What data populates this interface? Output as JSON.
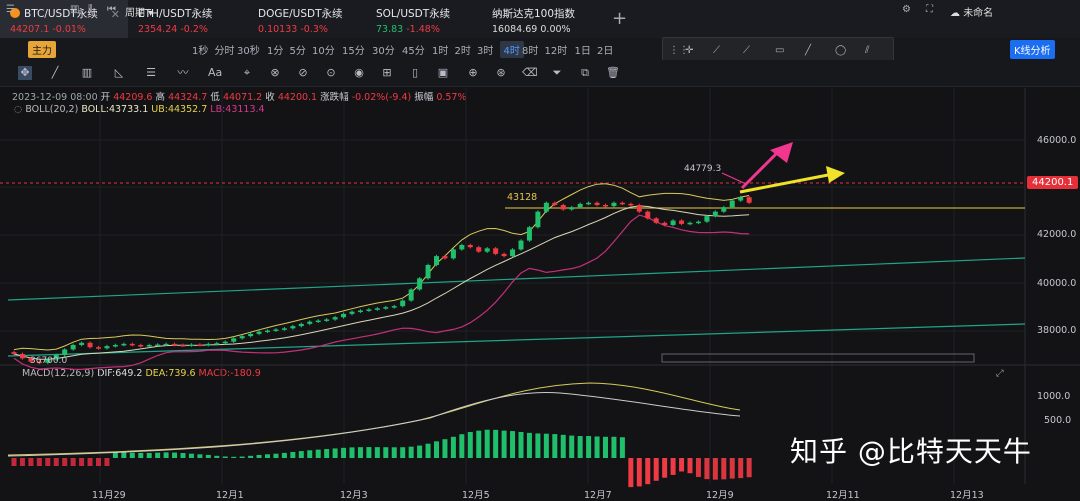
{
  "tabs": [
    {
      "symbol": "BTC/USDT永续",
      "price": "44207.1",
      "change": "-0.01%",
      "active": true
    },
    {
      "symbol": "ETH/USDT永续",
      "price": "2354.24",
      "change": "-0.2%"
    },
    {
      "symbol": "DOGE/USDT永续",
      "price": "0.10133",
      "change": "-0.3%"
    },
    {
      "symbol": "SOL/USDT永续",
      "price": "73.83",
      "change": "-1.48%"
    },
    {
      "symbol": "纳斯达克100指数",
      "price": "16084.69",
      "change": "0.00%"
    }
  ],
  "add_tab": "+",
  "toolbar": {
    "main_label": "主力",
    "period_label": "周期",
    "intervals": [
      "1秒",
      "分时",
      "30秒",
      "1分",
      "5分",
      "10分",
      "15分",
      "30分",
      "45分",
      "1时",
      "2时",
      "3时",
      "4时",
      "8时",
      "12时",
      "1日",
      "2日"
    ],
    "active_interval": "4时",
    "unnamed": "未命名",
    "kline_analysis": "K线分析"
  },
  "ohlc": {
    "date": "2023-12-09 08:00",
    "open_label": "开",
    "open": "44209.6",
    "high_label": "高",
    "high": "44324.7",
    "low_label": "低",
    "low": "44071.2",
    "close_label": "收",
    "close": "44200.1",
    "change_label": "涨跌幅",
    "change": "-0.02%(-9.4)",
    "amp_label": "振幅",
    "amp": "0.57%"
  },
  "boll": {
    "name": "BOLL(20,2)",
    "mid": "BOLL:43733.1",
    "ub": "UB:44352.7",
    "lb": "LB:43113.4"
  },
  "macd": {
    "name": "MACD(12,26,9)",
    "dif": "DIF:649.2",
    "dea": "DEA:739.6",
    "macd": "MACD:-180.9"
  },
  "price_axis": [
    "46000.0",
    "44000.0",
    "42000.0",
    "40000.0",
    "38000.0"
  ],
  "macd_axis": [
    "1000.0",
    "500.0"
  ],
  "current_price": "44200.1",
  "annotations": {
    "high": "44779.3",
    "level": "43128",
    "low": "36700.0"
  },
  "date_axis": [
    "11月29",
    "12月1",
    "12月3",
    "12月5",
    "12月7",
    "12月9",
    "12月11",
    "12月13"
  ],
  "watermark": "知乎 @比特天天牛",
  "chart_data": {
    "type": "candlestick",
    "interval": "4时",
    "ylim": [
      36000,
      46800
    ],
    "closes": [
      37400,
      37200,
      37050,
      37000,
      37150,
      37350,
      37600,
      37800,
      37900,
      37700,
      37650,
      37750,
      37800,
      37850,
      37800,
      37750,
      37800,
      37820,
      37850,
      37800,
      37780,
      37820,
      37800,
      37850,
      37880,
      37950,
      38100,
      38200,
      38300,
      38400,
      38450,
      38500,
      38550,
      38650,
      38750,
      38850,
      38900,
      38950,
      39050,
      39200,
      39300,
      39350,
      39400,
      39450,
      39500,
      39550,
      39800,
      40300,
      40800,
      41400,
      41800,
      41700,
      42100,
      42300,
      42200,
      42000,
      42150,
      41900,
      41800,
      42100,
      42500,
      43100,
      43800,
      44200,
      44100,
      43900,
      44000,
      44150,
      44200,
      44100,
      44050,
      44200,
      44150,
      44100,
      43800,
      43500,
      43300,
      43200,
      43400,
      43250,
      43300,
      43350,
      43600,
      43800,
      44000,
      44300,
      44450,
      44200
    ]
  }
}
